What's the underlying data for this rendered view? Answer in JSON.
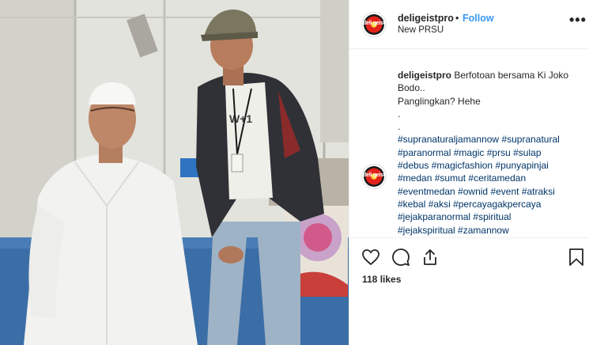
{
  "post": {
    "username": "deligeistpro",
    "separator": "•",
    "follow_label": "Follow",
    "location": "New PRSU",
    "more_label": "•••",
    "avatar_text": "deli geist"
  },
  "caption": {
    "username": "deligeistpro",
    "text_line1": "Berfotoan bersama Ki Joko Bodo..",
    "text_line2": "Panglingkan? Hehe",
    "dot1": ".",
    "dot2": ".",
    "hashtags": [
      "#supranaturaljamannow",
      "#supranatural",
      "#paranormal",
      "#magic",
      "#prsu",
      "#sulap",
      "#debus",
      "#magicfashion",
      "#punyapinjai",
      "#medan",
      "#sumut",
      "#ceritamedan",
      "#eventmedan",
      "#ownid",
      "#event",
      "#atraksi",
      "#kebal",
      "#aksi",
      "#percayagakpercaya",
      "#jejakparanormal",
      "#spiritual",
      "#jejakspiritual",
      "#zamannow"
    ]
  },
  "engagement": {
    "likes": "118 likes"
  },
  "icons": {
    "like": "heart-icon",
    "comment": "comment-icon",
    "share": "share-icon",
    "save": "bookmark-icon",
    "more": "more-icon"
  },
  "colors": {
    "link": "#003569",
    "follow": "#3897f0",
    "text": "#262626",
    "border": "#efefef"
  }
}
